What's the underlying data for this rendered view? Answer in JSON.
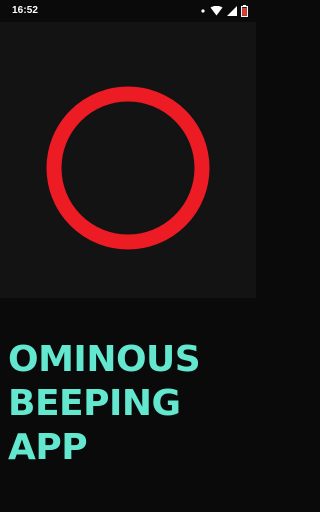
{
  "status_bar": {
    "time": "16:52",
    "icons": [
      "dot-icon",
      "wifi-icon",
      "signal-icon",
      "battery-icon"
    ]
  },
  "hero": {
    "indicator": "ring-icon",
    "ring_color": "#ed1c24",
    "background": "#141314"
  },
  "app": {
    "title_lines": [
      "OMINOUS",
      "BEEPING",
      "APP"
    ],
    "title_color": "#63e8cf"
  }
}
